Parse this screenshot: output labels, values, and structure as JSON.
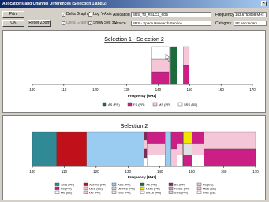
{
  "window": {
    "title": "Allocations and Channel Differences (Selection 1 and 2)"
  },
  "toolbar": {
    "print_label": "Print",
    "ok_label": "OK",
    "reset_zoom_label": "Reset Zoom",
    "delta_graph": "Delta Graph 1",
    "log_y": "Log Y-Axis",
    "delta_graph2": "Delta Graph 2",
    "show_sec": "Show Sec Sv",
    "allocation_label": "Allocation",
    "allocation_value": "SRS_T3_RSLC2_6G6",
    "service_label": "Service",
    "service_value": "SRS - Space Research Service",
    "frequency_label": "Frequency",
    "frequency_value": "143.6750098 MHz",
    "category_label": "Category",
    "category_value": "SE secondary"
  },
  "chart_top": {
    "title": "Selection 1 - Selection 2",
    "xlabel": "Frequency [MHz]",
    "ticks": [
      "100",
      "110",
      "120",
      "130",
      "140",
      "150",
      "160",
      "170"
    ],
    "legend": [
      "AS (PR)",
      "FS (PR)",
      "MS (PR)",
      "SRS (SE)"
    ]
  },
  "chart_bottom": {
    "title": "Selection 2",
    "xlabel": "Frequency [MHz]",
    "ticks": [
      "100",
      "110",
      "120",
      "130",
      "140",
      "150",
      "160",
      "170"
    ],
    "legend": [
      [
        "AMS (PR)",
        "FS (PR)",
        "MS (SE)"
      ],
      [
        "AERAS (PR)",
        "MSS (SE)",
        "MS (PR)"
      ],
      [
        "ASS (PR)",
        "METSS (PR)",
        "RAS (PR)"
      ],
      [
        "AS (PR)",
        "MMS (PR)",
        "SRAS (PR)"
      ],
      [
        "BS (PR)",
        "RNSS (PR)",
        "SOS (PR)"
      ],
      [
        "FS (SE)",
        "MSS (SE)",
        "SRS (SE)"
      ]
    ]
  },
  "chart_data": [
    {
      "type": "bar",
      "title": "Selection 1 - Selection 2",
      "xlabel": "Frequency [MHz]",
      "xlim": [
        100,
        170
      ],
      "series": [
        {
          "name": "AS (PR)",
          "color": "#1a6d3a",
          "ranges": [
            [
              144,
              146
            ]
          ]
        },
        {
          "name": "FS (PR)",
          "color": "#cc1f86",
          "ranges": [
            [
              138,
              143.5
            ],
            [
              148,
              149.9
            ]
          ]
        },
        {
          "name": "MS (PR)",
          "color": "#f4c6d8",
          "ranges": [
            [
              138,
              143.5
            ],
            [
              148,
              149.9
            ]
          ]
        },
        {
          "name": "SRS (SE)",
          "color": "#ffffff",
          "ranges": [
            [
              138,
              143.5
            ]
          ]
        }
      ]
    },
    {
      "type": "bar",
      "title": "Selection 2",
      "xlabel": "Frequency [MHz]",
      "xlim": [
        100,
        174
      ],
      "blocks": [
        {
          "start": 100,
          "end": 108,
          "layers": [
            "#2f8a96"
          ]
        },
        {
          "start": 108,
          "end": 117.975,
          "layers": [
            "#c0101a"
          ]
        },
        {
          "start": 117.975,
          "end": 137,
          "layers": [
            "#99ccf0"
          ]
        },
        {
          "start": 137,
          "end": 138,
          "layers": [
            "#7b2d5a",
            "#f4c6d8",
            "#7b2d5a",
            "#ffffff"
          ]
        },
        {
          "start": 138,
          "end": 144,
          "layers": [
            "#cc1f86",
            "#f4c6d8",
            "#ffffff"
          ]
        },
        {
          "start": 144,
          "end": 146,
          "layers": [
            "#99ccf0"
          ]
        },
        {
          "start": 146,
          "end": 148,
          "layers": [
            "#cc1f86",
            "#f4c6d8"
          ]
        },
        {
          "start": 148,
          "end": 149.9,
          "layers": [
            "#cc1f86",
            "#f4c6d8",
            "#ffffff"
          ]
        },
        {
          "start": 149.9,
          "end": 150.05,
          "layers": [
            "#7b2d5a"
          ]
        },
        {
          "start": 150.05,
          "end": 153,
          "layers": [
            "#f2e600",
            "#e0e0e0",
            "#cc1f86"
          ]
        },
        {
          "start": 153,
          "end": 156.8,
          "layers": [
            "#cc1f86",
            "#f4c6d8",
            "#ffffff"
          ]
        },
        {
          "start": 156.8,
          "end": 174,
          "layers": [
            "#f4c6d8",
            "#cc1f86"
          ]
        }
      ]
    }
  ],
  "colors": {
    "as_pr": "#1a6d3a",
    "fs_pr": "#cc1f86",
    "ms_pr": "#f4c6d8",
    "srs_se": "#ffffff",
    "ams": "#2f8a96",
    "aeras": "#c0101a",
    "ass": "#99ccf0",
    "mms": "#f2e600",
    "dark": "#7b2d5a"
  }
}
